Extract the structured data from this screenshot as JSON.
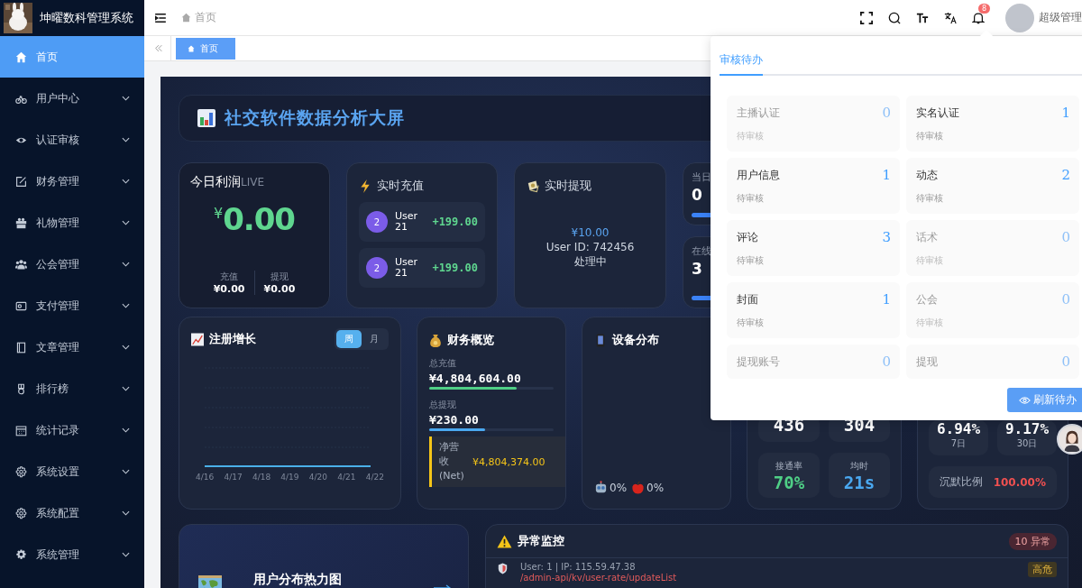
{
  "sidebar": {
    "title": "坤曜数科管理系统",
    "items": [
      {
        "label": "首页",
        "selected": true,
        "expandable": false
      },
      {
        "label": "用户中心",
        "selected": false,
        "expandable": true
      },
      {
        "label": "认证审核",
        "selected": false,
        "expandable": true
      },
      {
        "label": "财务管理",
        "selected": false,
        "expandable": true
      },
      {
        "label": "礼物管理",
        "selected": false,
        "expandable": true
      },
      {
        "label": "公会管理",
        "selected": false,
        "expandable": true
      },
      {
        "label": "支付管理",
        "selected": false,
        "expandable": true
      },
      {
        "label": "文章管理",
        "selected": false,
        "expandable": true
      },
      {
        "label": "排行榜",
        "selected": false,
        "expandable": true
      },
      {
        "label": "统计记录",
        "selected": false,
        "expandable": true
      },
      {
        "label": "系统设置",
        "selected": false,
        "expandable": true
      },
      {
        "label": "系统配置",
        "selected": false,
        "expandable": true
      },
      {
        "label": "系统管理",
        "selected": false,
        "expandable": true
      }
    ]
  },
  "header": {
    "breadcrumb": "首页",
    "notification_count": "8",
    "user_name": "超级管理"
  },
  "tabs": [
    {
      "label": "首页",
      "selected": true
    }
  ],
  "dashboard": {
    "title": "社交软件数据分析大屏",
    "profit": {
      "title": "今日利润",
      "live": "LIVE",
      "currency": "¥",
      "amount": "0.00",
      "stats": [
        {
          "label": "充值",
          "value": "¥0.00"
        },
        {
          "label": "提现",
          "value": "¥0.00"
        }
      ]
    },
    "recharge": {
      "title": "实时充值",
      "items": [
        {
          "avatar": "2",
          "user": "User 21",
          "amount": "+199.00"
        },
        {
          "avatar": "2",
          "user": "User 21",
          "amount": "+199.00"
        }
      ]
    },
    "withdraw": {
      "title": "实时提现",
      "amount": "¥10.00",
      "user": "User ID: 742456",
      "status": "处理中"
    },
    "counters": [
      {
        "label": "当日",
        "value": "0"
      },
      {
        "label": "在线",
        "value": "3"
      }
    ],
    "registration": {
      "title": "注册增长",
      "toggle": [
        {
          "label": "周",
          "selected": true
        },
        {
          "label": "月",
          "selected": false
        }
      ],
      "xlabels": [
        "4/16",
        "4/17",
        "4/18",
        "4/19",
        "4/20",
        "4/21",
        "4/22"
      ]
    },
    "finance": {
      "title": "财务概览",
      "rows": [
        {
          "label": "总充值",
          "value": "¥4,804,604.00",
          "level": 0.7,
          "color": "#4fcf86"
        },
        {
          "label": "总提现",
          "value": "¥230.00",
          "level": 0.45,
          "color": "#4aa8f0"
        }
      ],
      "net": {
        "label": "净营收(Net)",
        "value": "¥4,804,374.00"
      }
    },
    "devices": {
      "title": "设备分布",
      "shares": [
        {
          "kind": "android",
          "value": "0%"
        },
        {
          "kind": "ios",
          "value": "0%"
        }
      ]
    },
    "calls": {
      "tiles": [
        {
          "value": "436"
        },
        {
          "value": "304"
        },
        {
          "label": "接通率",
          "value": "70%",
          "color": "#4fcf86"
        },
        {
          "label": "均时",
          "value": "21s",
          "color": "#4aa8f0"
        }
      ]
    },
    "retention": {
      "tiles": [
        {
          "value": "6.94%",
          "label": "7日"
        },
        {
          "value": "9.17%",
          "label": "30日"
        }
      ],
      "silent": {
        "label": "沉默比例",
        "value": "100.00%"
      }
    },
    "heatmap": {
      "title": "用户分布热力图"
    },
    "alerts": {
      "title": "异常监控",
      "badge": "10 异常",
      "items": [
        {
          "user": "User: 1 | IP: 115.59.47.38",
          "path": "/admin-api/kv/user-rate/updateList",
          "severity": "高危"
        }
      ]
    }
  },
  "popup": {
    "tabs": [
      {
        "label": "审核待办",
        "selected": true
      }
    ],
    "items": [
      {
        "label": "主播认证",
        "count": "0",
        "sub": "待审核",
        "disabled": true
      },
      {
        "label": "实名认证",
        "count": "1",
        "sub": "待审核",
        "disabled": false
      },
      {
        "label": "用户信息",
        "count": "1",
        "sub": "待审核",
        "disabled": false
      },
      {
        "label": "动态",
        "count": "2",
        "sub": "待审核",
        "disabled": false
      },
      {
        "label": "评论",
        "count": "3",
        "sub": "待审核",
        "disabled": false
      },
      {
        "label": "话术",
        "count": "0",
        "sub": "待审核",
        "disabled": true
      },
      {
        "label": "封面",
        "count": "1",
        "sub": "待审核",
        "disabled": false
      },
      {
        "label": "公会",
        "count": "0",
        "sub": "待审核",
        "disabled": true
      },
      {
        "label": "提现账号",
        "count": "0",
        "disabled": true
      },
      {
        "label": "提现",
        "count": "0",
        "disabled": true
      }
    ],
    "button": "刷新待办"
  }
}
